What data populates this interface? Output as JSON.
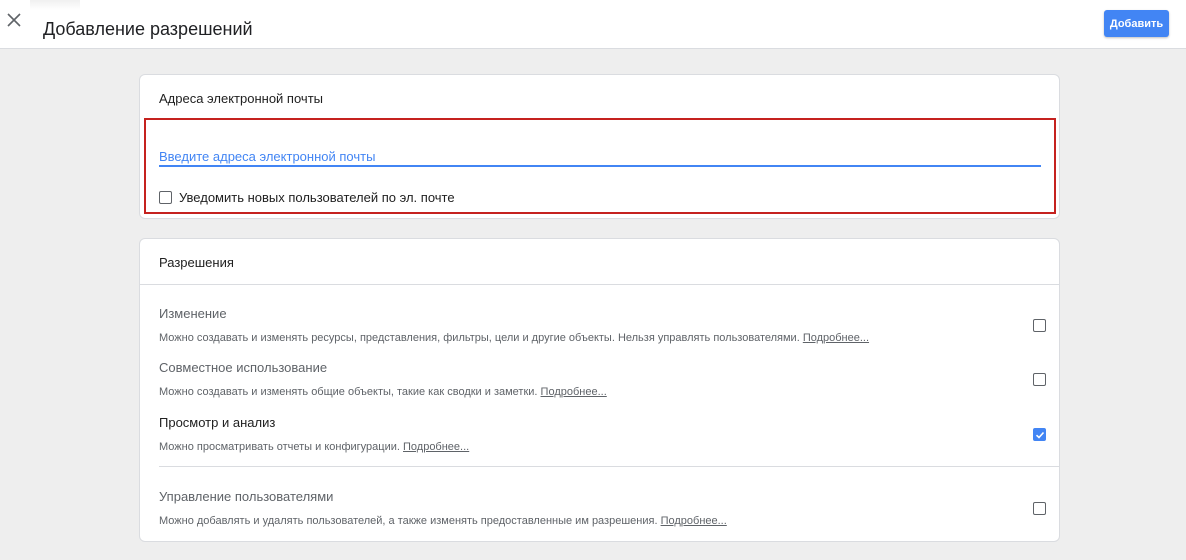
{
  "header": {
    "title": "Добавление разрешений",
    "add_label": "Добавить",
    "close_icon": "close-icon",
    "accent": "#4285f4"
  },
  "email_card": {
    "title": "Адреса электронной почты",
    "input_value": "",
    "input_placeholder": "Введите адреса электронной почты",
    "notify_label": "Уведомить новых пользователей по эл. почте",
    "notify_checked": false
  },
  "permissions_card": {
    "title": "Разрешения",
    "items": [
      {
        "name": "Изменение",
        "description": "Можно создавать и изменять ресурсы, представления, фильтры, цели и другие объекты. Нельзя управлять пользователями.",
        "link": "Подробнее...",
        "checked": false
      },
      {
        "name": "Совместное использование",
        "description": "Можно создавать и изменять общие объекты, такие как сводки и заметки.",
        "link": "Подробнее...",
        "checked": false
      },
      {
        "name": "Просмотр и анализ",
        "description": "Можно просматривать отчеты и конфигурации.",
        "link": "Подробнее...",
        "checked": true
      },
      {
        "name": "Управление пользователями",
        "description": "Можно добавлять и удалять пользователей, а также изменять предоставленные им разрешения.",
        "link": "Подробнее...",
        "checked": false
      }
    ]
  }
}
